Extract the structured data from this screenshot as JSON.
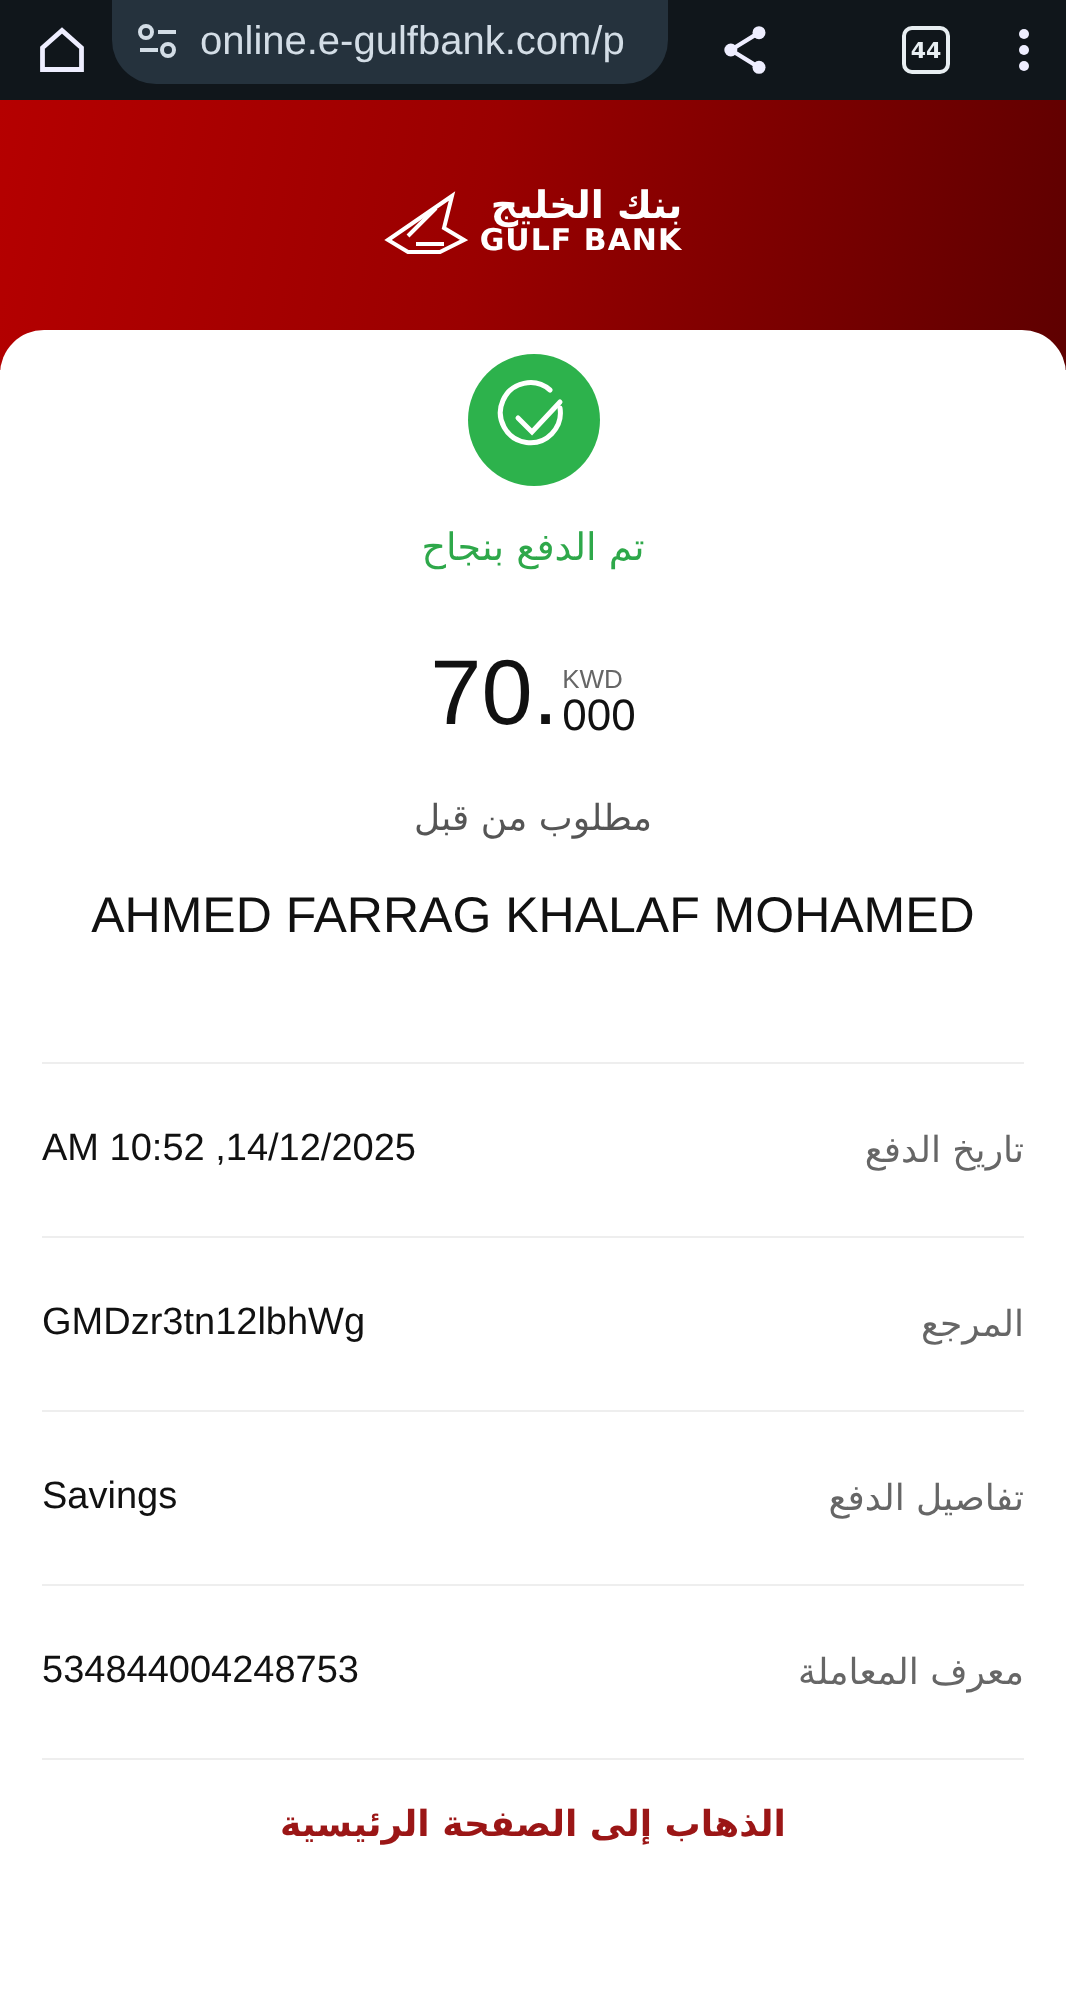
{
  "browser_bar": {
    "url": "online.e-gulfbank.com/p",
    "tab_count": "44"
  },
  "header": {
    "logo_arabic": "بنك الخليج",
    "logo_english": "GULF BANK"
  },
  "status": {
    "message": "تم الدفع بنجاح"
  },
  "amount": {
    "integer": "70.",
    "decimals": "000",
    "currency": "KWD"
  },
  "requested_by": {
    "label": "مطلوب من قبل",
    "name": "AHMED FARRAG KHALAF MOHAMED"
  },
  "details": [
    {
      "label": "تاريخ الدفع",
      "value": "AM 10:52 ,14/12/2025"
    },
    {
      "label": "المرجع",
      "value": "GMDzr3tn12lbhWg"
    },
    {
      "label": "تفاصيل الدفع",
      "value": "Savings"
    },
    {
      "label": "معرف المعاملة",
      "value": "534844004248753"
    }
  ],
  "home_link": "الذهاب إلى الصفحة الرئيسية"
}
